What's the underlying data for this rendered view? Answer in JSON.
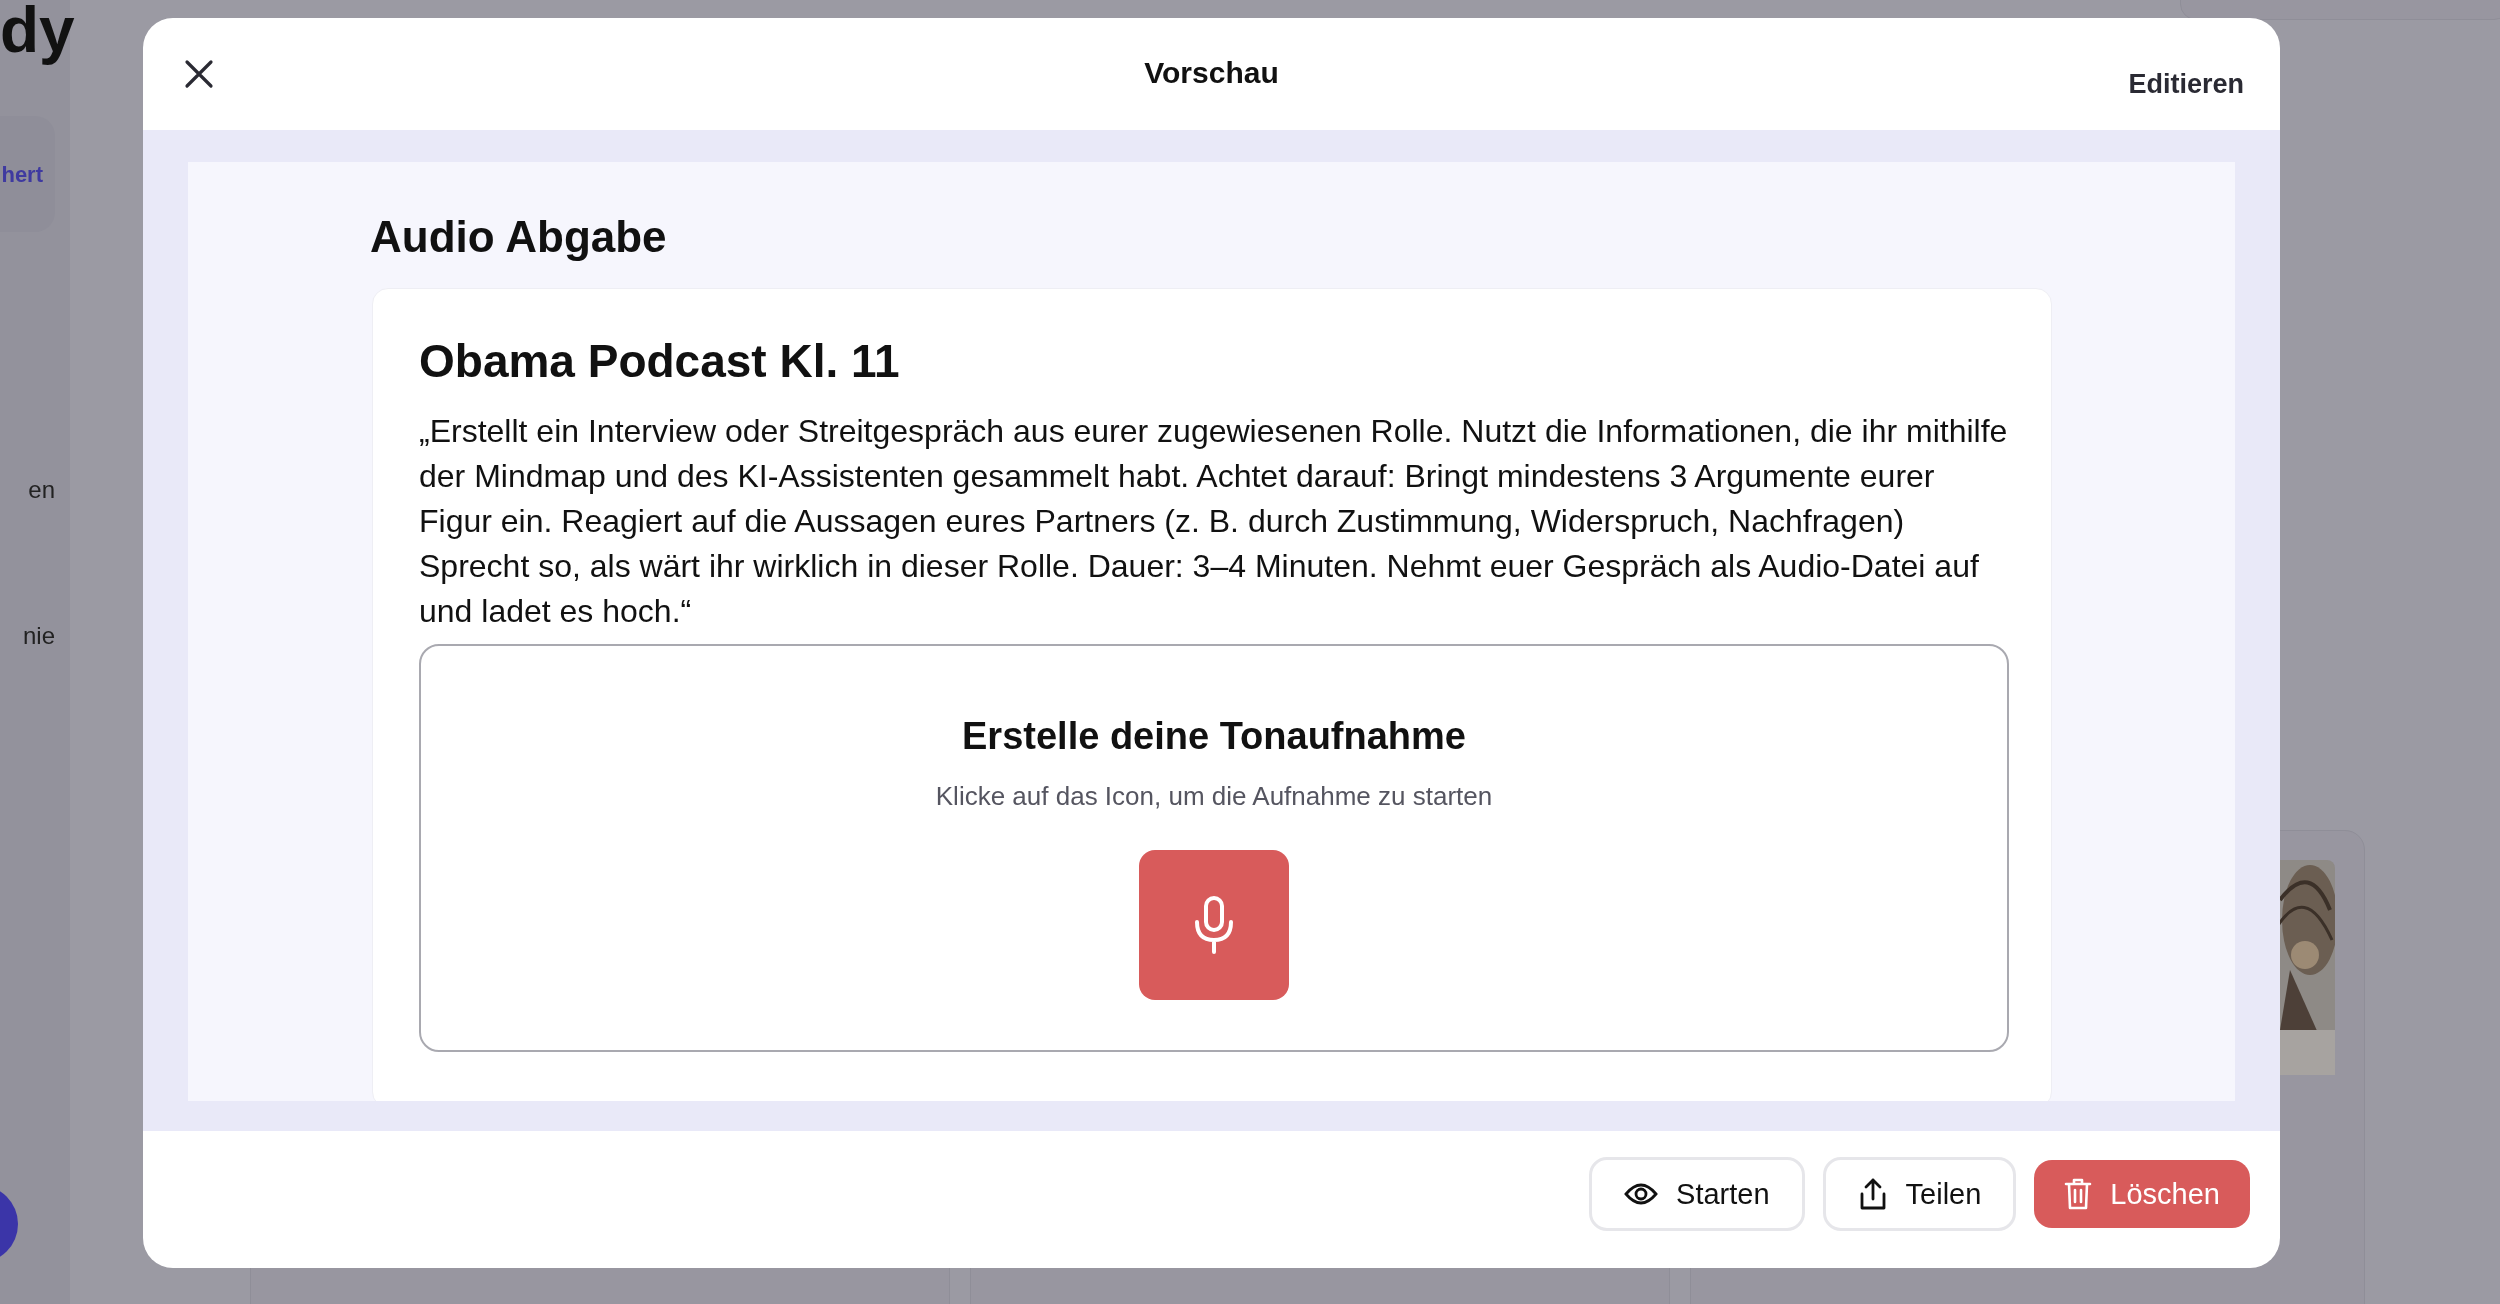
{
  "background": {
    "logo_text": "dy",
    "nav_items": [
      {
        "label": "hert",
        "selected": true
      },
      {
        "label": "en",
        "selected": false
      },
      {
        "label": "nie",
        "selected": false
      }
    ]
  },
  "dialog": {
    "title": "Vorschau",
    "edit_link": "Editieren",
    "section_title": "Audio Abgabe",
    "card": {
      "title": "Obama Podcast Kl. 11",
      "text": "„Erstellt ein Interview oder Streitgespräch aus eurer zugewiesenen Rolle. Nutzt die Informationen, die ihr mithilfe der Mindmap und des KI-Assistenten gesammelt habt. Achtet darauf: Bringt mindestens 3 Argumente eurer Figur ein. Reagiert auf die Aussagen eures Partners (z. B. durch Zustimmung, Widerspruch, Nachfragen) Sprecht so, als wärt ihr wirklich in dieser Rolle. Dauer: 3–4 Minuten. Nehmt euer Gespräch als Audio-Datei auf und ladet es hoch.“",
      "recorder": {
        "title": "Erstelle deine Tonaufnahme",
        "hint": "Klicke auf das Icon, um die Aufnahme zu starten"
      }
    },
    "buttons": [
      {
        "label": "Starten",
        "kind": "outline"
      },
      {
        "label": "Teilen",
        "kind": "outline"
      },
      {
        "label": "Löschen",
        "kind": "danger"
      }
    ]
  }
}
